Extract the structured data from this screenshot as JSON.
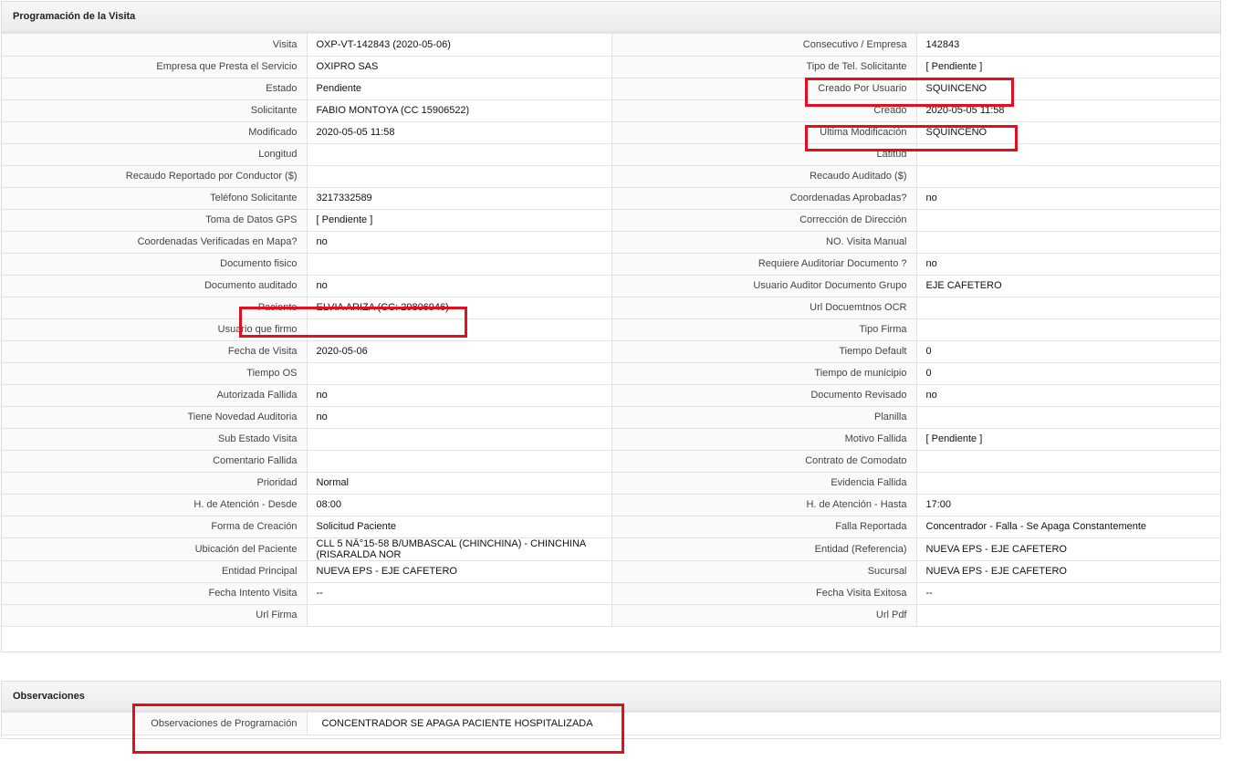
{
  "section1": {
    "title": "Programación de la Visita",
    "rows": [
      {
        "l1": "Visita",
        "v1": "OXP-VT-142843 (2020-05-06)",
        "l2": "Consecutivo / Empresa",
        "v2": "142843"
      },
      {
        "l1": "Empresa que Presta el Servicio",
        "v1": "OXIPRO SAS",
        "l2": "Tipo de Tel. Solicitante",
        "v2": "[ Pendiente ]"
      },
      {
        "l1": "Estado",
        "v1": "Pendiente",
        "l2": "Creado Por Usuario",
        "v2": "SQUINCENO"
      },
      {
        "l1": "Solicitante",
        "v1": "FABIO MONTOYA (CC 15906522)",
        "l2": "Creado",
        "v2": "2020-05-05 11:58"
      },
      {
        "l1": "Modificado",
        "v1": "2020-05-05 11:58",
        "l2": "Última Modificación",
        "v2": " SQUINCENO"
      },
      {
        "l1": "Longitud",
        "v1": "",
        "l2": "Latitud",
        "v2": ""
      },
      {
        "l1": "Recaudo Reportado por Conductor ($)",
        "v1": "",
        "l2": "Recaudo Auditado ($)",
        "v2": ""
      },
      {
        "l1": "Teléfono Solicitante",
        "v1": "3217332589",
        "l2": "Coordenadas Aprobadas?",
        "v2": " no"
      },
      {
        "l1": "Toma de Datos GPS",
        "v1": "[ Pendiente ]",
        "l2": "Corrección de Dirección",
        "v2": ""
      },
      {
        "l1": "Coordenadas Verificadas en Mapa?",
        "v1": " no",
        "l2": "NO. Visita Manual",
        "v2": ""
      },
      {
        "l1": "Documento fisico",
        "v1": "",
        "l2": "Requiere Auditoriar Documento ?",
        "v2": " no"
      },
      {
        "l1": "Documento auditado",
        "v1": " no",
        "l2": "Usuario Auditor Documento Grupo",
        "v2": "EJE CAFETERO"
      },
      {
        "l1": "Paciente",
        "v1": "ELVIA ARIZA (CC: 29806946)",
        "l2": "Url Docuemtnos OCR",
        "v2": ""
      },
      {
        "l1": "Usuario que firmo",
        "v1": "",
        "l2": "Tipo Firma",
        "v2": ""
      },
      {
        "l1": "Fecha de Visita",
        "v1": " 2020-05-06",
        "l2": "Tiempo Default",
        "v2": "0"
      },
      {
        "l1": "Tiempo OS",
        "v1": "",
        "l2": "Tiempo de municipio",
        "v2": "0"
      },
      {
        "l1": "Autorizada Fallida",
        "v1": " no",
        "l2": "Documento Revisado",
        "v2": " no"
      },
      {
        "l1": "Tiene Novedad Auditoria",
        "v1": " no",
        "l2": "Planilla",
        "v2": ""
      },
      {
        "l1": "Sub Estado Visita",
        "v1": "",
        "l2": "Motivo Fallida",
        "v2": "[ Pendiente ]"
      },
      {
        "l1": "Comentario Fallida",
        "v1": "",
        "l2": "Contrato de Comodato",
        "v2": ""
      },
      {
        "l1": "Prioridad",
        "v1": "Normal",
        "l2": "Evidencia Fallida",
        "v2": ""
      },
      {
        "l1": "H. de Atención - Desde",
        "v1": "08:00",
        "l2": "H. de Atención - Hasta",
        "v2": "17:00"
      },
      {
        "l1": "Forma de Creación",
        "v1": "Solicitud Paciente",
        "l2": "Falla Reportada",
        "v2": "Concentrador - Falla - Se Apaga Constantemente"
      },
      {
        "l1": "Ubicación del Paciente",
        "v1": "CLL 5 NÂ°15-58 B/UMBASCAL (CHINCHINA) - CHINCHINA (RISARALDA NOR",
        "l2": "Entidad (Referencia)",
        "v2": "NUEVA EPS - EJE CAFETERO"
      },
      {
        "l1": "Entidad Principal",
        "v1": "NUEVA EPS - EJE CAFETERO",
        "l2": "Sucursal",
        "v2": "NUEVA EPS - EJE CAFETERO"
      },
      {
        "l1": "Fecha Intento Visita",
        "v1": " --",
        "l2": "Fecha Visita Exitosa",
        "v2": " --"
      },
      {
        "l1": "Url Firma",
        "v1": "",
        "l2": "Url Pdf",
        "v2": ""
      }
    ]
  },
  "section2": {
    "title": "Observaciones",
    "label": "Observaciones de Programación",
    "value": "CONCENTRADOR SE APAGA PACIENTE HOSPITALIZADA"
  }
}
